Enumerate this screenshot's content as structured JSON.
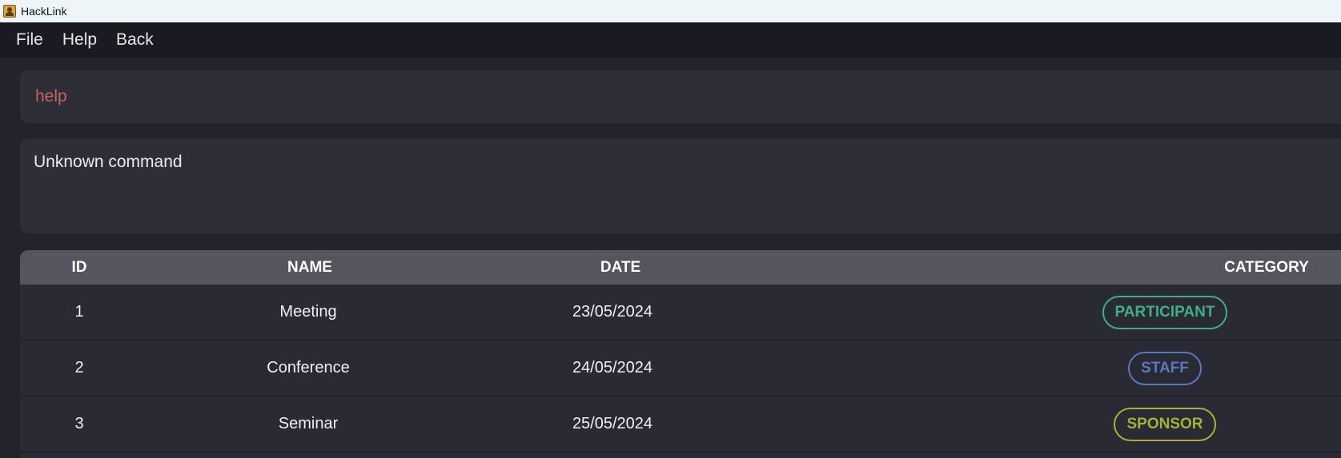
{
  "window": {
    "title": "HackLink"
  },
  "menu": {
    "items": [
      "File",
      "Help",
      "Back"
    ]
  },
  "command": {
    "value": "help"
  },
  "result": {
    "text": "Unknown command"
  },
  "table": {
    "headers": {
      "id": "ID",
      "name": "NAME",
      "date": "DATE",
      "category": "CATEGORY"
    },
    "rows": [
      {
        "id": "1",
        "name": "Meeting",
        "date": "23/05/2024",
        "category": "PARTICIPANT",
        "color": "#3fae83"
      },
      {
        "id": "2",
        "name": "Conference",
        "date": "24/05/2024",
        "category": "STAFF",
        "color": "#5a78bf"
      },
      {
        "id": "3",
        "name": "Seminar",
        "date": "25/05/2024",
        "category": "SPONSOR",
        "color": "#a7b13a"
      }
    ]
  },
  "icons": {
    "app": "hacklink-app-icon"
  }
}
